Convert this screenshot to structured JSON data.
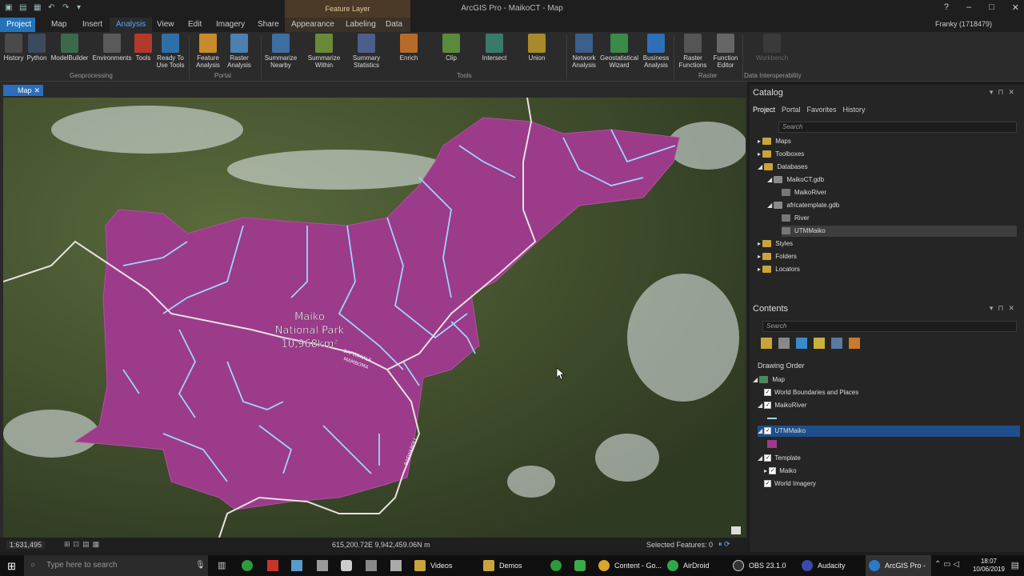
{
  "window": {
    "title": "ArcGIS Pro - MaikoCT - Map",
    "contextual_group": "Feature Layer",
    "user": "Franky (1718479)"
  },
  "tabs": [
    "Project",
    "Map",
    "Insert",
    "Analysis",
    "View",
    "Edit",
    "Imagery",
    "Share",
    "Appearance",
    "Labeling",
    "Data"
  ],
  "ribbon": {
    "geoprocessing": {
      "label": "Geoprocessing",
      "items": [
        "History",
        "Python",
        "ModelBuilder",
        "Environments",
        "Tools"
      ]
    },
    "portal": {
      "label": "Portal",
      "items": [
        "Ready To\nUse Tools",
        "Feature\nAnalysis",
        "Raster\nAnalysis"
      ]
    },
    "tools": {
      "label": "Tools",
      "items": [
        "Summarize\nNearby",
        "Summarize\nWithin",
        "Summary\nStatistics",
        "Enrich",
        "Clip",
        "Intersect",
        "Union"
      ]
    },
    "network": {
      "items": [
        "Network\nAnalysis",
        "Geostatistical\nWizard",
        "Business\nAnalysis"
      ]
    },
    "raster": {
      "label": "Raster",
      "items": [
        "Raster\nFunctions",
        "Function\nEditor"
      ]
    },
    "interop": {
      "label": "Data Interoperability",
      "items": [
        "Workbench"
      ]
    }
  },
  "map": {
    "tab_label": "Map",
    "label_line1": "Maiko",
    "label_line2": "National Park",
    "label_line3": "10,968km²",
    "road_label1": "BAFWAKALE",
    "road_label2": "MAMBOMA",
    "road_label3": "BAFWABOLI",
    "scale": "1:631,495",
    "coords": "615,200.72E 9,942,459.06N m",
    "selected_features": "Selected Features: 0"
  },
  "catalog": {
    "title": "Catalog",
    "tabs": [
      "Project",
      "Portal",
      "Favorites",
      "History"
    ],
    "search_placeholder": "Search",
    "items": [
      "Maps",
      "Toolboxes",
      "Databases",
      "MaikoCT.gdb",
      "MaikoRiver",
      "africatemplate.gdb",
      "River",
      "UTMMaiko",
      "Styles",
      "Folders",
      "Locators"
    ]
  },
  "contents": {
    "title": "Contents",
    "search_placeholder": "Search",
    "section": "Drawing Order",
    "layers": [
      "Map",
      "World Boundaries and Places",
      "MaikoRiver",
      "UTMMaiko",
      "Template",
      "Maiko",
      "World Imagery"
    ]
  },
  "taskbar": {
    "search_placeholder": "Type here to search",
    "items": [
      "Videos",
      "Demos",
      "Content - Go...",
      "AirDroid",
      "OBS 23.1.0 (6...",
      "Audacity",
      "ArcGIS Pro - ..."
    ],
    "time": "18:07",
    "date": "10/06/2019"
  },
  "colors": {
    "park": "#9b3b8a",
    "river": "#9fd3ff",
    "road": "#e8e0e6",
    "accent": "#2572b9"
  }
}
